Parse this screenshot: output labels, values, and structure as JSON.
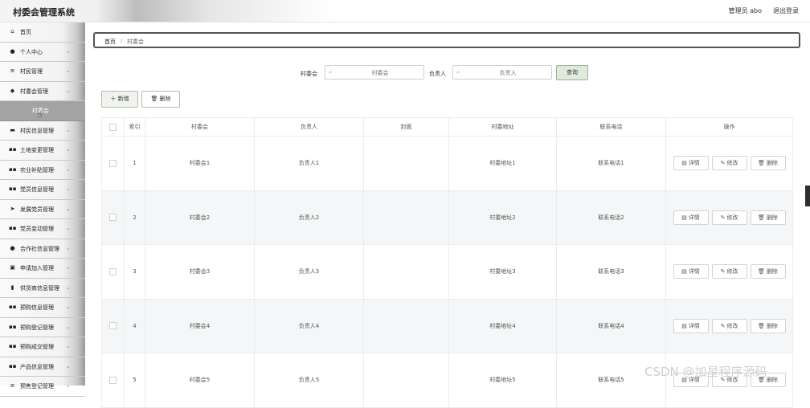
{
  "header": {
    "title": "村委会管理系统",
    "admin": "管理员 abo",
    "logout": "退出登录"
  },
  "sidebar": {
    "items": [
      {
        "icon": "⌂",
        "label": "首页",
        "chevron": ""
      },
      {
        "icon": "●",
        "label": "个人中心",
        "chevron": "⌄"
      },
      {
        "icon": "≡",
        "label": "村民管理",
        "chevron": "⌄"
      },
      {
        "icon": "◆",
        "label": "村委会管理",
        "chevron": "⌄"
      },
      {
        "icon": "",
        "label": "村委会",
        "chevron": ""
      },
      {
        "icon": "▬",
        "label": "村民信息管理",
        "chevron": "⌄"
      },
      {
        "icon": "▪▪",
        "label": "土地变更管理",
        "chevron": "⌄"
      },
      {
        "icon": "▪▪",
        "label": "农业补贴管理",
        "chevron": "⌄"
      },
      {
        "icon": "▪▪",
        "label": "党员信息管理",
        "chevron": "⌄"
      },
      {
        "icon": "➤",
        "label": "发展党员管理",
        "chevron": "⌄"
      },
      {
        "icon": "▪▪",
        "label": "党员变动管理",
        "chevron": "⌄"
      },
      {
        "icon": "●",
        "label": "合作社信息管理",
        "chevron": "⌄"
      },
      {
        "icon": "▣",
        "label": "申请加入管理",
        "chevron": "⌄"
      },
      {
        "icon": "▮",
        "label": "供货商信息管理",
        "chevron": "⌄"
      },
      {
        "icon": "▪▪",
        "label": "预购信息管理",
        "chevron": "⌄"
      },
      {
        "icon": "▪▪",
        "label": "预购登记管理",
        "chevron": "⌄"
      },
      {
        "icon": "▪▪",
        "label": "预购成交管理",
        "chevron": "⌄"
      },
      {
        "icon": "▪▪",
        "label": "产品信息管理",
        "chevron": "⌄"
      },
      {
        "icon": "≡",
        "label": "预售登记管理",
        "chevron": "⌄"
      }
    ]
  },
  "breadcrumb": {
    "home": "首页",
    "sep": "/",
    "current": "村委会"
  },
  "search": {
    "label1": "村委会",
    "placeholder1": "村委会",
    "label2": "负责人",
    "placeholder2": "负责人",
    "query_label": "查询"
  },
  "actions": {
    "add_label": "＋ 新增",
    "delete_label": "🗑 删除"
  },
  "table": {
    "headers": [
      "",
      "索引",
      "村委会",
      "负责人",
      "封面",
      "村委地址",
      "联系电话",
      "操作"
    ],
    "rows": [
      {
        "index": "1",
        "name": "村委会1",
        "leader": "负责人1",
        "cover": "",
        "address": "村委地址1",
        "phone": "联系电话1"
      },
      {
        "index": "2",
        "name": "村委会2",
        "leader": "负责人2",
        "cover": "",
        "address": "村委地址2",
        "phone": "联系电话2"
      },
      {
        "index": "3",
        "name": "村委会3",
        "leader": "负责人3",
        "cover": "",
        "address": "村委地址3",
        "phone": "联系电话3"
      },
      {
        "index": "4",
        "name": "村委会4",
        "leader": "负责人4",
        "cover": "",
        "address": "村委地址4",
        "phone": "联系电话4"
      },
      {
        "index": "5",
        "name": "村委会5",
        "leader": "负责人5",
        "cover": "",
        "address": "村委地址5",
        "phone": "联系电话5"
      }
    ],
    "op_detail": "详情",
    "op_edit": "修改",
    "op_delete": "删除"
  },
  "watermark": "CSDN @加星程序源码"
}
